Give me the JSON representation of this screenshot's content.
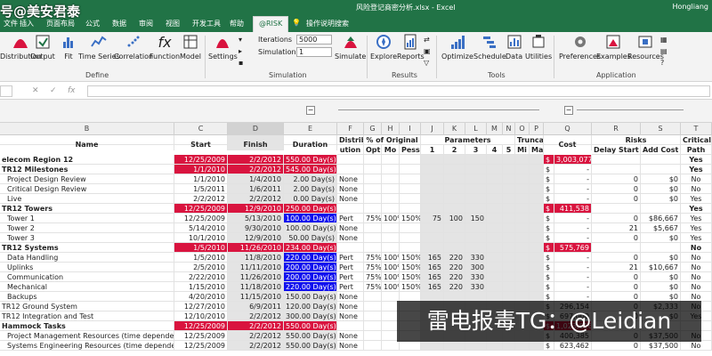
{
  "watermark_top": "号@美安君泰",
  "window": {
    "title": "风险登记商密分析.xlsx  -  Excel",
    "user": "Hongliang"
  },
  "tabs": [
    {
      "label": "文件"
    },
    {
      "label": "插入"
    },
    {
      "label": "页面布局"
    },
    {
      "label": "公式"
    },
    {
      "label": "数据"
    },
    {
      "label": "审阅"
    },
    {
      "label": "视图"
    },
    {
      "label": "开发工具"
    },
    {
      "label": "帮助"
    },
    {
      "label": "@RISK"
    },
    {
      "label": "操作说明搜索"
    }
  ],
  "ribbon": {
    "define": {
      "label": "Define",
      "buttons": [
        "Distribution",
        "Output",
        "Fit",
        "Time Series",
        "Correlation",
        "Function",
        "Model"
      ]
    },
    "simulation": {
      "label": "Simulation",
      "settings": "Settings",
      "iterations_label": "Iterations",
      "iterations_value": "5000",
      "simulations_label": "Simulations",
      "simulations_value": "1",
      "simulate": "Simulate"
    },
    "results": {
      "label": "Results",
      "buttons": [
        "Explore",
        "Reports"
      ]
    },
    "tools": {
      "label": "Tools",
      "buttons": [
        "Optimize",
        "Schedule",
        "Data",
        "Utilities"
      ]
    },
    "application": {
      "label": "Application",
      "buttons": [
        "Preferences",
        "Examples",
        "Resources"
      ]
    }
  },
  "columns": [
    {
      "label": "B"
    },
    {
      "label": "C"
    },
    {
      "label": "D"
    },
    {
      "label": "E"
    },
    {
      "label": "F"
    },
    {
      "label": "G"
    },
    {
      "label": "H"
    },
    {
      "label": "I"
    },
    {
      "label": "J"
    },
    {
      "label": "K"
    },
    {
      "label": "L"
    },
    {
      "label": "M"
    },
    {
      "label": "N"
    },
    {
      "label": "O"
    },
    {
      "label": "P"
    },
    {
      "label": "Q"
    },
    {
      "label": "R"
    },
    {
      "label": "S"
    },
    {
      "label": "T"
    }
  ],
  "headers": {
    "name": "Name",
    "start": "Start",
    "finish": "Finish",
    "duration": "Duration",
    "distrib1": "Distrib",
    "distrib2": "ution",
    "pct_original": "% of Original",
    "opt": "Opt",
    "mo": "Mo",
    "pessi": "Pessi",
    "parameters": "Parameters",
    "p1": "1",
    "p2": "2",
    "p3": "3",
    "p4": "4",
    "p5": "5",
    "truncat": "Truncat",
    "mi": "Mi",
    "ma": "Ma",
    "cost": "Cost",
    "risks": "Risks",
    "delay_start": "Delay Start",
    "add_cost": "Add Cost",
    "critical1": "Critical",
    "critical2": "Path"
  },
  "rows": [
    {
      "name": "elecom Region 12",
      "start": "12/25/2009",
      "finish": "2/2/2012",
      "duration": "550.00 Day(s)?",
      "cur": "$",
      "cost": "3,003,077",
      "crit": "Yes",
      "style": "summary"
    },
    {
      "name": "TR12 Milestones",
      "start": "1/1/2010",
      "finish": "2/2/2012",
      "duration": "545.00 Day(s)",
      "cur": "$",
      "cost": "-",
      "crit": "Yes",
      "style": "summary"
    },
    {
      "name": "Project Design Review",
      "start": "1/1/2010",
      "finish": "1/4/2010",
      "duration": "2.00 Day(s)",
      "dist": "None",
      "cur": "$",
      "cost": "-",
      "delay": "0",
      "addc": "$0",
      "crit": "No",
      "style": "task"
    },
    {
      "name": "Critical Design Review",
      "start": "1/5/2011",
      "finish": "1/6/2011",
      "duration": "2.00 Day(s)",
      "dist": "None",
      "cur": "$",
      "cost": "-",
      "delay": "0",
      "addc": "$0",
      "crit": "No",
      "style": "task"
    },
    {
      "name": "Live",
      "start": "2/2/2012",
      "finish": "2/2/2012",
      "duration": "0.00 Day(s)",
      "dist": "None",
      "cur": "$",
      "cost": "-",
      "delay": "0",
      "addc": "$0",
      "crit": "Yes",
      "style": "task"
    },
    {
      "name": "TR12 Towers",
      "start": "12/25/2009",
      "finish": "12/9/2010",
      "duration": "250.00 Day(s)",
      "cur": "$",
      "cost": "411,538",
      "crit": "Yes",
      "style": "summary"
    },
    {
      "name": "Tower 1",
      "start": "12/25/2009",
      "finish": "5/13/2010",
      "duration": "100.00 Day(s)",
      "dist": "Pert",
      "opt": "75%",
      "mo": "100%",
      "pe": "150%",
      "p1": "75",
      "p2": "100",
      "p3": "150",
      "cur": "$",
      "cost": "-",
      "delay": "0",
      "addc": "$86,667",
      "crit": "Yes",
      "style": "task",
      "blue": true
    },
    {
      "name": "Tower 2",
      "start": "5/14/2010",
      "finish": "9/30/2010",
      "duration": "100.00 Day(s)",
      "dist": "None",
      "cur": "$",
      "cost": "-",
      "delay": "21",
      "addc": "$5,667",
      "crit": "Yes",
      "style": "task"
    },
    {
      "name": "Tower 3",
      "start": "10/1/2010",
      "finish": "12/9/2010",
      "duration": "50.00 Day(s)",
      "dist": "None",
      "cur": "$",
      "cost": "-",
      "delay": "0",
      "addc": "$0",
      "crit": "Yes",
      "style": "task"
    },
    {
      "name": "TR12 Systems",
      "start": "1/5/2010",
      "finish": "11/26/2010",
      "duration": "234.00 Day(s)",
      "cur": "$",
      "cost": "575,769",
      "crit": "No",
      "style": "summary"
    },
    {
      "name": "Data Handling",
      "start": "1/5/2010",
      "finish": "11/8/2010",
      "duration": "220.00 Day(s)",
      "dist": "Pert",
      "opt": "75%",
      "mo": "100%",
      "pe": "150%",
      "p1": "165",
      "p2": "220",
      "p3": "330",
      "cur": "$",
      "cost": "-",
      "delay": "0",
      "addc": "$0",
      "crit": "No",
      "style": "task",
      "blue": true
    },
    {
      "name": "Uplinks",
      "start": "2/5/2010",
      "finish": "11/11/2010",
      "duration": "200.00 Day(s)",
      "dist": "Pert",
      "opt": "75%",
      "mo": "100%",
      "pe": "150%",
      "p1": "165",
      "p2": "220",
      "p3": "300",
      "cur": "$",
      "cost": "-",
      "delay": "21",
      "addc": "$10,667",
      "crit": "No",
      "style": "task",
      "blue": true
    },
    {
      "name": "Communication",
      "start": "2/22/2010",
      "finish": "11/26/2010",
      "duration": "200.00 Day(s)",
      "dist": "Pert",
      "opt": "75%",
      "mo": "100%",
      "pe": "150%",
      "p1": "165",
      "p2": "220",
      "p3": "330",
      "cur": "$",
      "cost": "-",
      "delay": "0",
      "addc": "$0",
      "crit": "No",
      "style": "task",
      "blue": true
    },
    {
      "name": "Mechanical",
      "start": "1/15/2010",
      "finish": "11/18/2010",
      "duration": "220.00 Day(s)",
      "dist": "Pert",
      "opt": "75%",
      "mo": "100%",
      "pe": "150%",
      "p1": "165",
      "p2": "220",
      "p3": "330",
      "cur": "$",
      "cost": "-",
      "delay": "0",
      "addc": "$0",
      "crit": "No",
      "style": "task",
      "blue": true
    },
    {
      "name": "Backups",
      "start": "4/20/2010",
      "finish": "11/15/2010",
      "duration": "150.00 Day(s)",
      "dist": "None",
      "cur": "$",
      "cost": "-",
      "delay": "0",
      "addc": "$0",
      "crit": "No",
      "style": "task"
    },
    {
      "name": "TR12 Ground System",
      "start": "12/27/2010",
      "finish": "6/9/2011",
      "duration": "120.00 Day(s)",
      "dist": "None",
      "cur": "$",
      "cost": "296,154",
      "delay": "0",
      "addc": "$2,333",
      "crit": "No",
      "style": "plain"
    },
    {
      "name": "TR12 Integration and Test",
      "start": "12/10/2010",
      "finish": "2/2/2012",
      "duration": "300.00 Day(s)",
      "dist": "None",
      "cur": "$",
      "cost": "697,000",
      "delay": "0",
      "addc": "$0",
      "crit": "Yes",
      "style": "plain"
    },
    {
      "name": "Hammock Tasks",
      "start": "12/25/2009",
      "finish": "2/2/2012",
      "duration": "550.00 Day(s)?",
      "cur": "$",
      "cost": "1,023,616",
      "crit": "",
      "style": "summary"
    },
    {
      "name": "Project Management Resources (time dependent)",
      "start": "12/25/2009",
      "finish": "2/2/2012",
      "duration": "550.00 Day(s)?",
      "dist": "None",
      "cur": "$",
      "cost": "400,385",
      "delay": "0",
      "addc": "$37,500",
      "crit": "No",
      "style": "task"
    },
    {
      "name": "Systems Engineering Resources (time dependent)",
      "start": "12/25/2009",
      "finish": "2/2/2012",
      "duration": "550.00 Day(s)?",
      "dist": "None",
      "cur": "$",
      "cost": "623,462",
      "delay": "0",
      "addc": "$37,500",
      "crit": "No",
      "style": "task"
    }
  ],
  "watermark": "雷电报毒TG：@Leidian",
  "colors": {
    "excel_green": "#217346",
    "summary_red": "#d9143f",
    "duration_blue": "#1010ee"
  }
}
